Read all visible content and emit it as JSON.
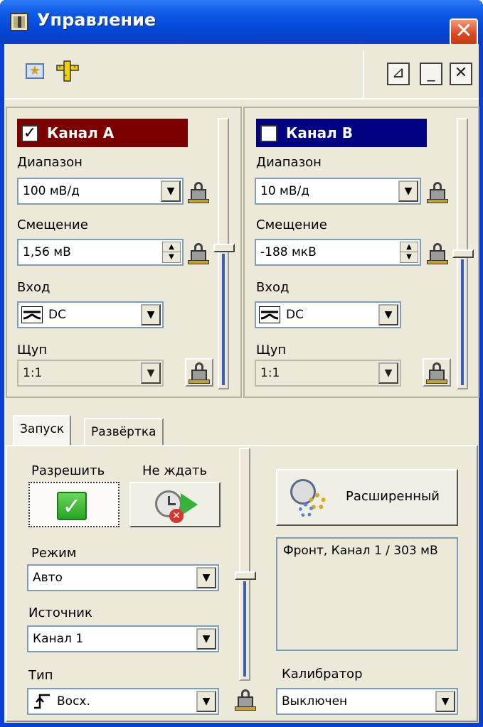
{
  "window": {
    "title": "Управление",
    "close_symbol": "✕"
  },
  "toolbar": {
    "left_icons": [
      "star-icon",
      "ruler-icon"
    ],
    "right_buttons": [
      {
        "icon": "pin-icon",
        "symbol": "⊿"
      },
      {
        "icon": "minimize-icon",
        "symbol": "_"
      },
      {
        "icon": "close-icon",
        "symbol": "✕"
      }
    ]
  },
  "channel_a": {
    "title": "Канал A",
    "enabled": true,
    "color": "#7b0000",
    "range_label": "Диапазон",
    "range_value": "100 мВ/д",
    "offset_label": "Смещение",
    "offset_value": "1,56 мВ",
    "input_label": "Вход",
    "input_value": "DC",
    "probe_label": "Щуп",
    "probe_value": "1:1",
    "slider_level": 0.48
  },
  "channel_b": {
    "title": "Канал B",
    "enabled": false,
    "color": "#000080",
    "range_label": "Диапазон",
    "range_value": "10 мВ/д",
    "offset_label": "Смещение",
    "offset_value": "-188 мкВ",
    "input_label": "Вход",
    "input_value": "DC",
    "probe_label": "Щуп",
    "probe_value": "1:1",
    "slider_level": 0.5
  },
  "tabs": [
    {
      "label": "Запуск",
      "active": true
    },
    {
      "label": "Развёртка",
      "active": false
    }
  ],
  "trigger": {
    "enable_label": "Разрешить",
    "nowait_label": "Не ждать",
    "mode_label": "Режим",
    "mode_value": "Авто",
    "source_label": "Источник",
    "source_value": "Канал 1",
    "type_label": "Тип",
    "type_value": "Восх.",
    "advanced_label": "Расширенный",
    "info_text": "Фронт, Канал 1 / 303 мВ",
    "calibrator_label": "Калибратор",
    "calibrator_value": "Выключен",
    "slider_level": 0.55
  },
  "colors": {
    "titlebar": "#0a3fd4",
    "face": "#ece9d8",
    "slider_fill": "#3c5fb6"
  }
}
